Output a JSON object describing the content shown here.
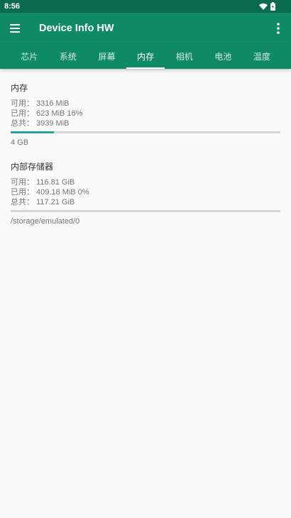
{
  "status_bar": {
    "time": "8:56"
  },
  "app_bar": {
    "title": "Device Info HW"
  },
  "icons": {
    "menu": "hamburger-menu-icon",
    "more": "more-vert-icon",
    "wifi": "wifi-icon",
    "battery": "battery-icon"
  },
  "tabs": [
    {
      "label": "芯片"
    },
    {
      "label": "系统"
    },
    {
      "label": "屏幕"
    },
    {
      "label": "内存",
      "selected": true
    },
    {
      "label": "相机"
    },
    {
      "label": "电池"
    },
    {
      "label": "温度"
    }
  ],
  "sections": [
    {
      "title": "内存",
      "rows": [
        {
          "label": "可用：",
          "value": "3316 MiB"
        },
        {
          "label": "已用：",
          "value": "623 MiB",
          "percent": "16%"
        },
        {
          "label": "总共：",
          "value": "3939 MiB"
        }
      ],
      "used_fraction": 0.16,
      "footer": "4 GB"
    },
    {
      "title": "内部存储器",
      "rows": [
        {
          "label": "可用：",
          "value": "116.81 GiB"
        },
        {
          "label": "已用：",
          "value": "409.18 MiB",
          "percent": "0%"
        },
        {
          "label": "总共：",
          "value": "117.21 GiB"
        }
      ],
      "used_fraction": 0.0,
      "footer": "/storage/emulated/0"
    }
  ],
  "colors": {
    "status_bar": "#0a6a4d",
    "app_bar": "#0e8a65",
    "background": "#fafafa",
    "progress_track": "#d6d6d6",
    "progress_fill": "#26a69a"
  }
}
